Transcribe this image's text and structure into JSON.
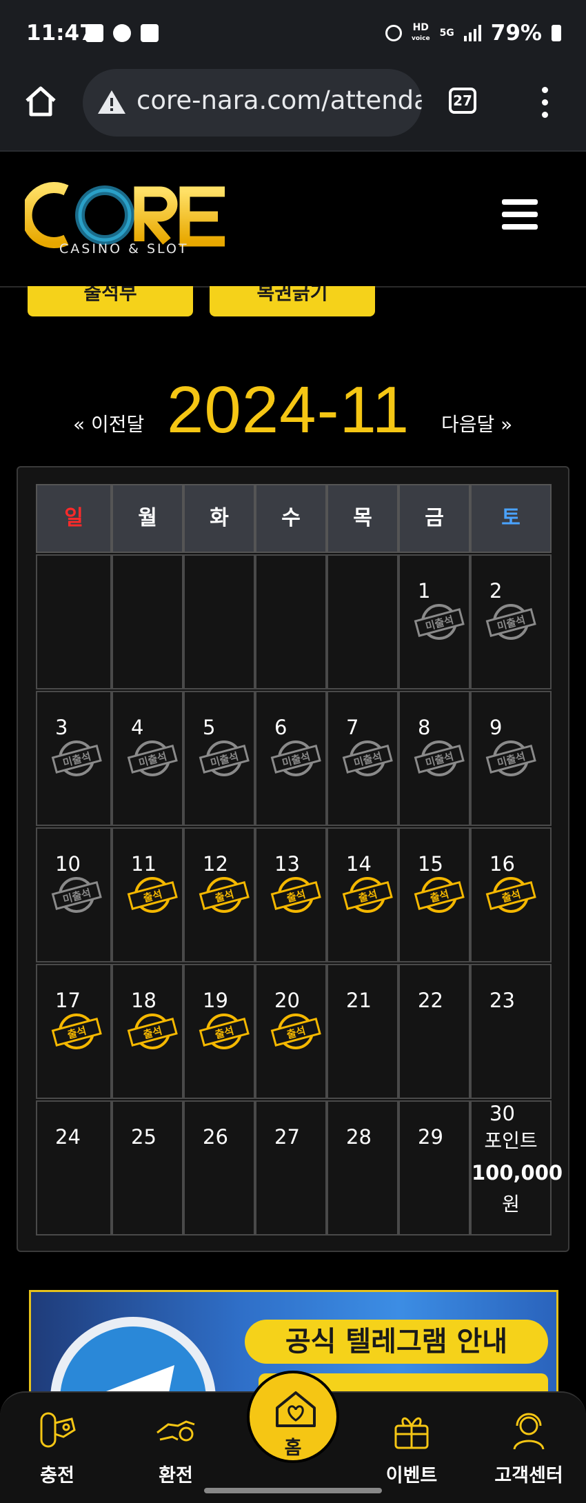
{
  "status_bar": {
    "time": "11:47",
    "battery": "79%",
    "hd_label": "HD",
    "voice_label": "voice",
    "net_label": "5G"
  },
  "browser": {
    "url": "core-nara.com/attenda",
    "tab_count": "27"
  },
  "site": {
    "logo_text": "CORE",
    "logo_sub": "CASINO & SLOT"
  },
  "tabs": [
    {
      "label": "출석부"
    },
    {
      "label": "복권긁기"
    }
  ],
  "calendar": {
    "prev_label": "« 이전달",
    "month": "2024-11",
    "next_label": "다음달 »",
    "weekdays": [
      {
        "label": "일",
        "color": "#ff2a2a"
      },
      {
        "label": "월",
        "color": "#ffffff"
      },
      {
        "label": "화",
        "color": "#ffffff"
      },
      {
        "label": "수",
        "color": "#ffffff"
      },
      {
        "label": "목",
        "color": "#ffffff"
      },
      {
        "label": "금",
        "color": "#ffffff"
      },
      {
        "label": "토",
        "color": "#4aa3ff"
      }
    ],
    "weeks": [
      [
        {
          "day": ""
        },
        {
          "day": ""
        },
        {
          "day": ""
        },
        {
          "day": ""
        },
        {
          "day": ""
        },
        {
          "day": "1",
          "stamp": "miss"
        },
        {
          "day": "2",
          "stamp": "miss"
        }
      ],
      [
        {
          "day": "3",
          "stamp": "miss"
        },
        {
          "day": "4",
          "stamp": "miss"
        },
        {
          "day": "5",
          "stamp": "miss"
        },
        {
          "day": "6",
          "stamp": "miss"
        },
        {
          "day": "7",
          "stamp": "miss"
        },
        {
          "day": "8",
          "stamp": "miss"
        },
        {
          "day": "9",
          "stamp": "miss"
        }
      ],
      [
        {
          "day": "10",
          "stamp": "miss"
        },
        {
          "day": "11",
          "stamp": "attend"
        },
        {
          "day": "12",
          "stamp": "attend"
        },
        {
          "day": "13",
          "stamp": "attend"
        },
        {
          "day": "14",
          "stamp": "attend"
        },
        {
          "day": "15",
          "stamp": "attend"
        },
        {
          "day": "16",
          "stamp": "attend"
        }
      ],
      [
        {
          "day": "17",
          "stamp": "attend"
        },
        {
          "day": "18",
          "stamp": "attend"
        },
        {
          "day": "19",
          "stamp": "attend"
        },
        {
          "day": "20",
          "stamp": "attend"
        },
        {
          "day": "21"
        },
        {
          "day": "22"
        },
        {
          "day": "23"
        }
      ],
      [
        {
          "day": "24"
        },
        {
          "day": "25"
        },
        {
          "day": "26"
        },
        {
          "day": "27"
        },
        {
          "day": "28"
        },
        {
          "day": "29"
        },
        {
          "day": "30",
          "reward": [
            "포인트",
            "100,000",
            "원"
          ]
        }
      ]
    ],
    "stamp_labels": {
      "miss": "미출석",
      "attend": "출석"
    },
    "stamp_colors": {
      "miss": "#8a8a8a",
      "attend": "#f5b800"
    }
  },
  "banner": {
    "title": "공식 텔레그램 안내"
  },
  "bottom_nav": [
    {
      "label": "충전",
      "icon": "deposit-icon"
    },
    {
      "label": "환전",
      "icon": "withdraw-icon"
    },
    {
      "label": "홈",
      "icon": "home-heart-icon"
    },
    {
      "label": "이벤트",
      "icon": "gift-icon"
    },
    {
      "label": "고객센터",
      "icon": "support-icon"
    }
  ],
  "colors": {
    "accent": "#f5c614",
    "background": "#000000"
  }
}
